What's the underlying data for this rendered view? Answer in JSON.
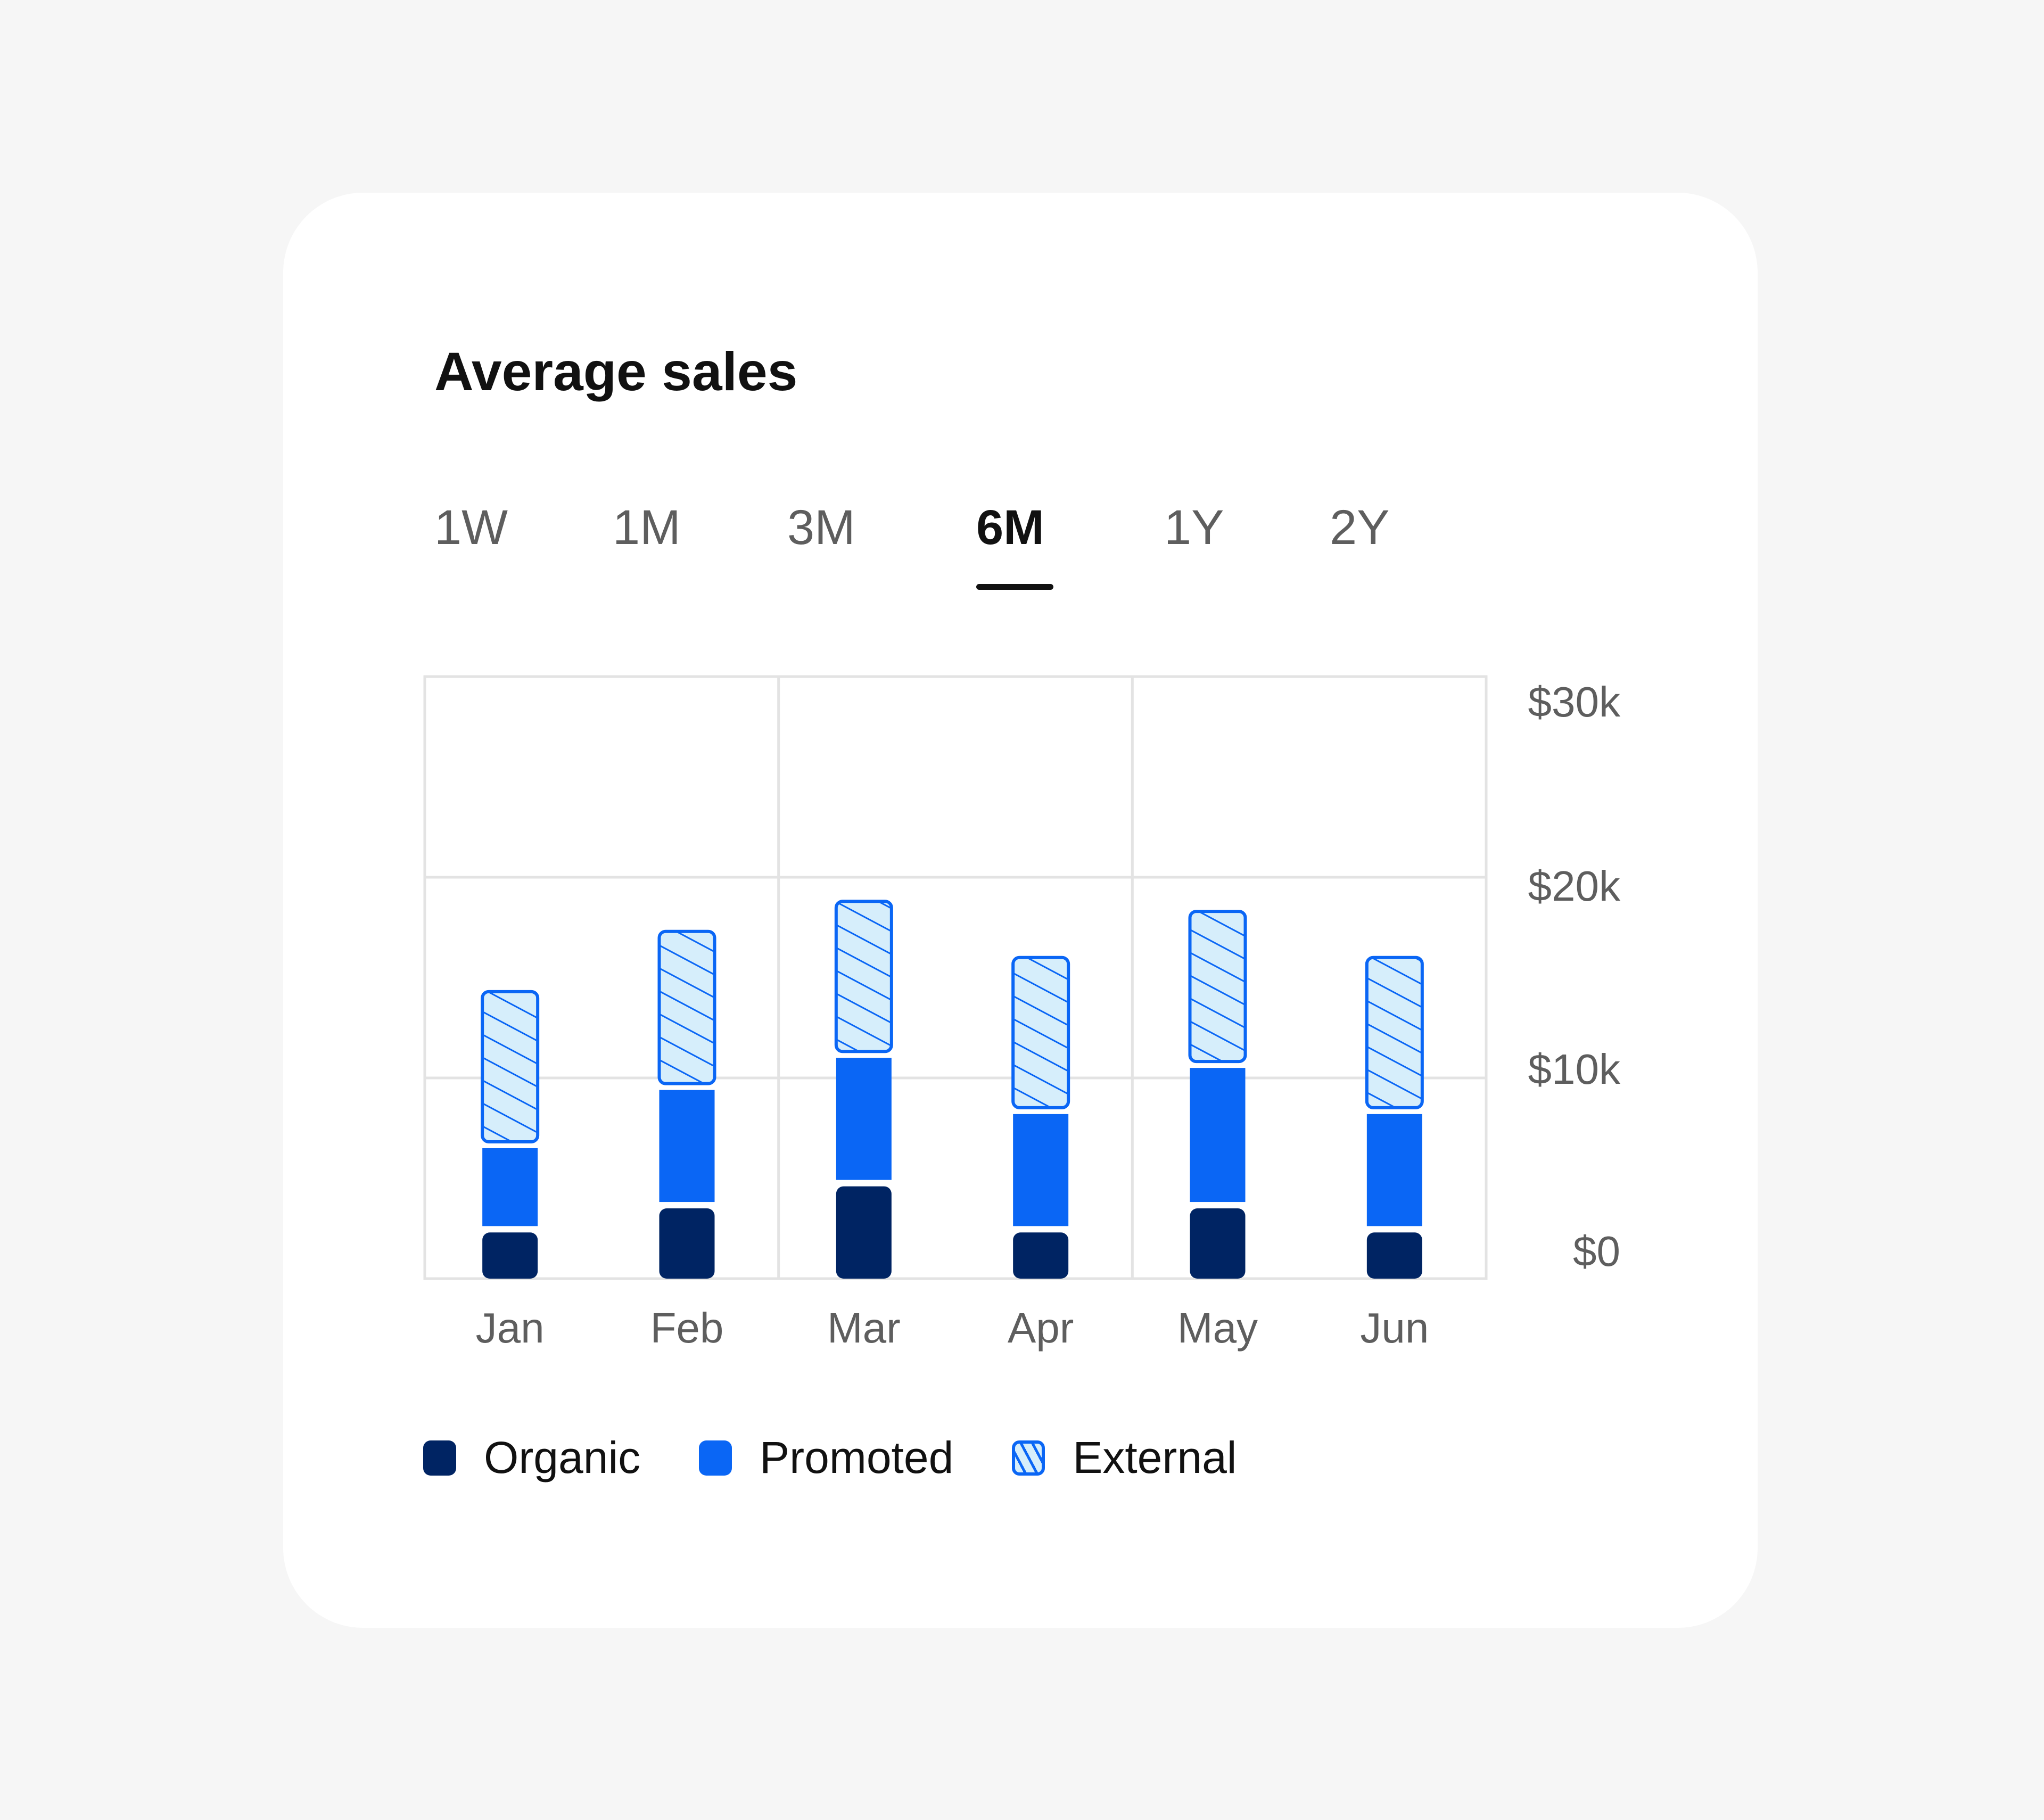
{
  "card": {
    "title": "Average sales"
  },
  "tabs": [
    {
      "label": "1W",
      "active": false
    },
    {
      "label": "1M",
      "active": false
    },
    {
      "label": "3M",
      "active": false
    },
    {
      "label": "6M",
      "active": true
    },
    {
      "label": "1Y",
      "active": false
    },
    {
      "label": "2Y",
      "active": false
    }
  ],
  "colors": {
    "background": "#f6f6f6",
    "card": "#ffffff",
    "organic": "#002463",
    "promoted": "#0a66f5",
    "external_fill": "#d6eefb",
    "external_stroke": "#0a66f5",
    "grid": "#e3e3e3"
  },
  "legend": [
    {
      "label": "Organic",
      "key": "organic"
    },
    {
      "label": "Promoted",
      "key": "promoted"
    },
    {
      "label": "External",
      "key": "external"
    }
  ],
  "chart_data": {
    "type": "bar",
    "stacked": true,
    "title": "Average sales",
    "xlabel": "",
    "ylabel": "",
    "categories": [
      "Jan",
      "Feb",
      "Mar",
      "Apr",
      "May",
      "Jun"
    ],
    "series": [
      {
        "name": "Organic",
        "values": [
          2.3,
          3.5,
          4.6,
          2.3,
          3.5,
          2.3
        ],
        "unit": "$k"
      },
      {
        "name": "Promoted",
        "values": [
          4.2,
          5.9,
          6.4,
          5.9,
          7.0,
          5.9
        ],
        "unit": "$k"
      },
      {
        "name": "External",
        "values": [
          7.8,
          7.9,
          7.8,
          7.8,
          7.8,
          7.8
        ],
        "unit": "$k"
      }
    ],
    "ylim": [
      0,
      30
    ],
    "yticks": [
      0,
      10,
      20,
      30
    ],
    "ytick_labels": [
      "$0",
      "$10k",
      "$20k",
      "$30k"
    ],
    "y_axis_side": "right",
    "grid": true,
    "legend_position": "bottom-left"
  }
}
